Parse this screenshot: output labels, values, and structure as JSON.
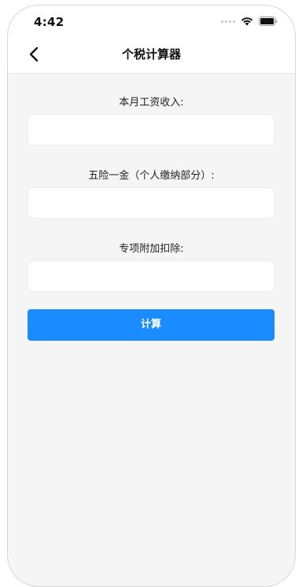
{
  "status_bar": {
    "time": "4:42",
    "icons": [
      "signal-dots-icon",
      "wifi-icon",
      "battery-icon"
    ]
  },
  "nav": {
    "back_icon": "chevron-left-icon",
    "title": "个税计算器"
  },
  "form": {
    "salary_label": "本月工资收入:",
    "salary_value": "",
    "insurance_label": "五险一金（个人缴纳部分）:",
    "insurance_value": "",
    "deduction_label": "专项附加扣除:",
    "deduction_value": "",
    "calculate_label": "计算"
  },
  "colors": {
    "accent": "#1a8cff",
    "background": "#f5f5f5"
  }
}
